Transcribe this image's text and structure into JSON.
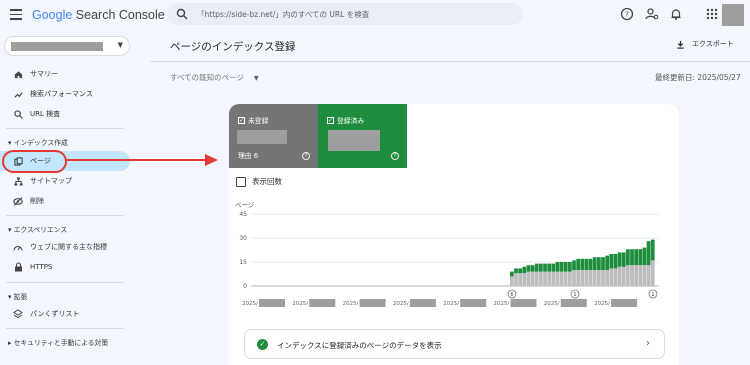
{
  "app": {
    "logo_google": "Google",
    "logo_product": "Search Console",
    "search_placeholder": "「https://side-bz.net/」内のすべての URL を検査"
  },
  "icons": {
    "menu": "menu-icon",
    "search": "search-icon",
    "help": "help-icon",
    "account_settings": "account-settings-icon",
    "notifications": "bell-icon",
    "apps": "apps-grid-icon",
    "download": "download-icon"
  },
  "sidebar": {
    "items_top": [
      {
        "label": "サマリー",
        "icon": "home-icon"
      },
      {
        "label": "検索パフォーマンス",
        "icon": "trending-icon"
      },
      {
        "label": "URL 検査",
        "icon": "search-icon"
      }
    ],
    "section_index": "インデックス作成",
    "items_index": [
      {
        "label": "ページ",
        "icon": "pages-icon"
      },
      {
        "label": "サイトマップ",
        "icon": "sitemap-icon"
      },
      {
        "label": "削除",
        "icon": "removal-icon"
      }
    ],
    "section_experience": "エクスペリエンス",
    "items_experience": [
      {
        "label": "ウェブに関する主な指標",
        "icon": "speed-icon"
      },
      {
        "label": "HTTPS",
        "icon": "lock-icon"
      }
    ],
    "section_enhancements": "拡張",
    "items_enhancements": [
      {
        "label": "パンくずリスト",
        "icon": "layers-icon"
      }
    ],
    "section_security": "セキュリティと手動による対策"
  },
  "main": {
    "title": "ページのインデックス登録",
    "export_label": "エクスポート",
    "filter_label": "すべての既知のページ",
    "last_updated": "最終更新日: 2025/05/27",
    "tiles": {
      "not_indexed_label": "未登録",
      "not_indexed_sub": "理由 6",
      "indexed_label": "登録済み"
    },
    "impressions_label": "表示回数",
    "link_label": "インデックスに登録済みのページのデータを表示"
  },
  "colors": {
    "indexed": "#1e8e3e",
    "not_indexed": "#757575",
    "nav_active": "#c2e7ff",
    "annotation": "#e53935"
  },
  "chart_data": {
    "type": "bar",
    "stacked": true,
    "ylabel": "ページ",
    "yticks": [
      0,
      15,
      30,
      45
    ],
    "ylim": [
      0,
      45
    ],
    "x_tick_labels": [
      "2025/",
      "2025/",
      "2025/",
      "2025/",
      "2025/",
      "2025/",
      "2025/",
      "2025/"
    ],
    "markers": [
      "6",
      "1",
      "1"
    ],
    "series": [
      {
        "color": "#bdbdbd",
        "values": [
          6,
          8,
          8,
          8,
          9,
          9,
          9,
          9,
          9,
          9,
          9,
          9,
          9,
          9,
          9,
          10,
          10,
          10,
          10,
          10,
          10,
          10,
          10,
          10,
          11,
          11,
          12,
          12,
          13,
          13,
          13,
          13,
          13,
          13,
          16
        ]
      },
      {
        "color": "#1e8e3e",
        "values": [
          3,
          3,
          3,
          4,
          4,
          4,
          5,
          5,
          5,
          5,
          5,
          6,
          6,
          6,
          6,
          6,
          7,
          7,
          7,
          7,
          8,
          8,
          8,
          9,
          9,
          9,
          9,
          9,
          10,
          10,
          10,
          10,
          11,
          15,
          13
        ]
      }
    ]
  }
}
